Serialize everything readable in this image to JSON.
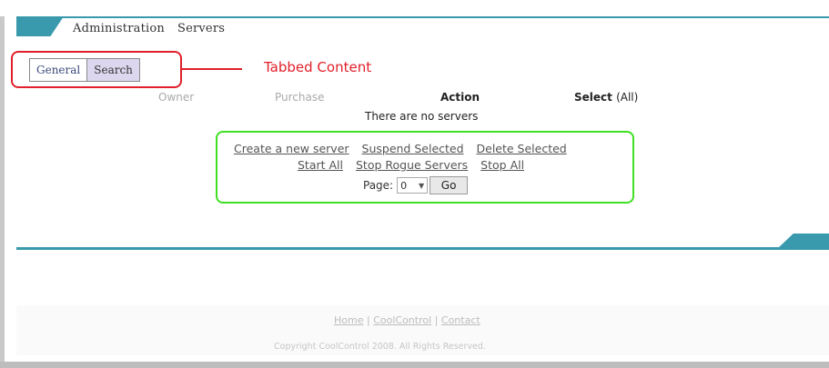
{
  "header": {
    "breadcrumb": [
      "Administration",
      "Servers"
    ]
  },
  "tabs": [
    {
      "label": "General"
    },
    {
      "label": "Search"
    }
  ],
  "annotations": {
    "tabbed_content": "Tabbed Content"
  },
  "table": {
    "headers": {
      "owner": "Owner",
      "purchase": "Purchase",
      "action": "Action",
      "select": "Select",
      "select_all": "(All)"
    },
    "empty_message": "There are no servers"
  },
  "actions": {
    "row1": [
      "Create a new server",
      "Suspend Selected",
      "Delete Selected"
    ],
    "row2": [
      "Start All",
      "Stop Rogue Servers",
      "Stop All"
    ],
    "page_label": "Page:",
    "page_value": "0",
    "go_label": "Go"
  },
  "footer": {
    "links": [
      "Home",
      "CoolControl",
      "Contact"
    ],
    "separator": "|",
    "copyright": "Copyright CoolControl 2008. All Rights Reserved."
  },
  "colors": {
    "accent_teal": "#3a9aad",
    "annotation_red": "#e0202a",
    "annotation_green": "#3fe022",
    "tab_selected_bg": "#dcd7ee"
  }
}
